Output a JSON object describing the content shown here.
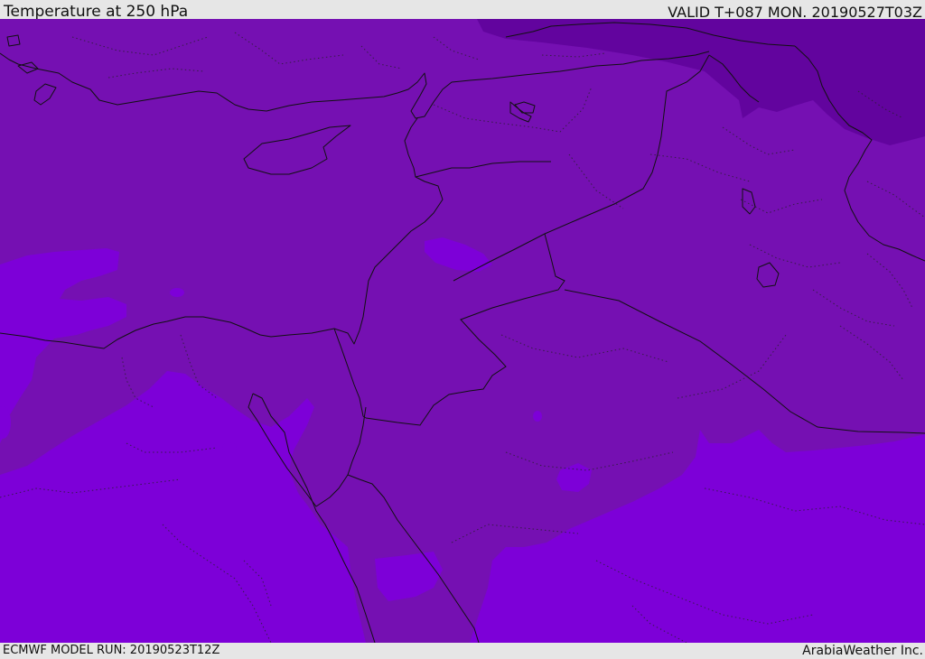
{
  "header": {
    "title": "Temperature at 250 hPa",
    "valid": "VALID T+087 MON. 20190527T03Z"
  },
  "footer": {
    "model_run": "ECMWF MODEL RUN: 20190523T12Z",
    "credit": "ArabiaWeather Inc."
  },
  "map": {
    "field": "temperature-250hPa",
    "colors": {
      "warm_band": "#7d00d8",
      "mid_band": "#7510b2",
      "cold_band": "#62049e",
      "lines": "#111111"
    }
  }
}
